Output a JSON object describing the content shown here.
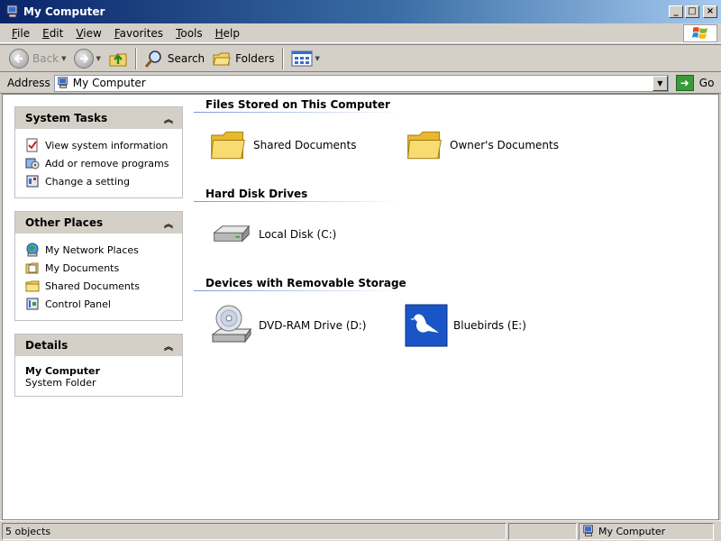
{
  "window": {
    "title": "My Computer"
  },
  "menu": [
    {
      "label": "File",
      "accel": "F",
      "rest": "ile"
    },
    {
      "label": "Edit",
      "accel": "E",
      "rest": "dit"
    },
    {
      "label": "View",
      "accel": "V",
      "rest": "iew"
    },
    {
      "label": "Favorites",
      "accel": "F",
      "rest": "avorites"
    },
    {
      "label": "Tools",
      "accel": "T",
      "rest": "ools"
    },
    {
      "label": "Help",
      "accel": "H",
      "rest": "elp"
    }
  ],
  "toolbar": {
    "back_label": "Back",
    "search_label": "Search",
    "folders_label": "Folders"
  },
  "address": {
    "label": "Address",
    "value": "My Computer",
    "go_label": "Go"
  },
  "system_tasks": {
    "title": "System Tasks",
    "items": [
      "View system information",
      "Add or remove programs",
      "Change a setting"
    ]
  },
  "other_places": {
    "title": "Other Places",
    "items": [
      "My Network Places",
      "My Documents",
      "Shared Documents",
      "Control Panel"
    ]
  },
  "details": {
    "title": "Details",
    "name": "My Computer",
    "type": "System Folder"
  },
  "groups": {
    "files": {
      "title": "Files Stored on This Computer",
      "items": [
        "Shared Documents",
        "Owner's Documents"
      ]
    },
    "disks": {
      "title": "Hard Disk Drives",
      "items": [
        "Local Disk (C:)"
      ]
    },
    "removable": {
      "title": "Devices with Removable Storage",
      "items": [
        "DVD-RAM Drive (D:)",
        "Bluebirds (E:)"
      ]
    }
  },
  "status": {
    "count": "5 objects",
    "location": "My Computer"
  }
}
